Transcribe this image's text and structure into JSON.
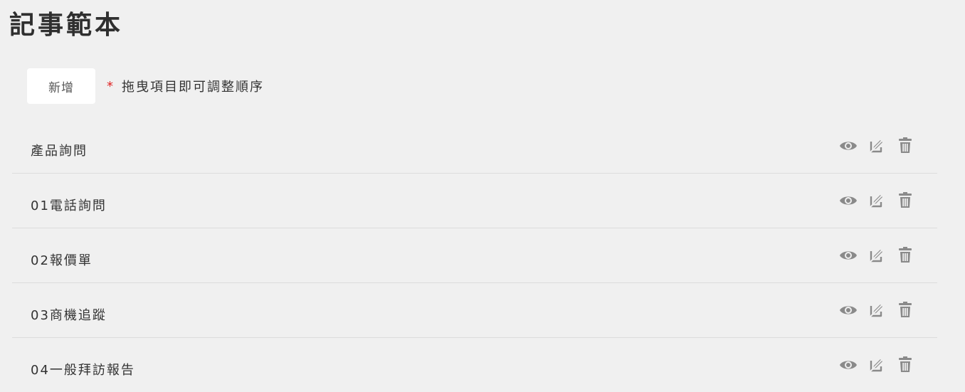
{
  "page": {
    "title": "記事範本"
  },
  "toolbar": {
    "add_label": "新增",
    "hint_asterisk": "*",
    "hint_text": "拖曳項目即可調整順序"
  },
  "colors": {
    "background": "#f0f0f0",
    "asterisk": "#e02424",
    "icon": "#8a8a8a",
    "divider": "#dcdcdc"
  },
  "templates": [
    {
      "label": "產品詢問",
      "icons": [
        "eye-icon",
        "edit-icon",
        "trash-icon"
      ]
    },
    {
      "label": "01電話詢問",
      "icons": [
        "eye-icon",
        "edit-icon",
        "trash-icon"
      ]
    },
    {
      "label": "02報價單",
      "icons": [
        "eye-icon",
        "edit-icon",
        "trash-icon"
      ]
    },
    {
      "label": "03商機追蹤",
      "icons": [
        "eye-icon",
        "edit-icon",
        "trash-icon"
      ]
    },
    {
      "label": "04一般拜訪報告",
      "icons": [
        "eye-icon",
        "edit-icon",
        "trash-icon"
      ]
    }
  ]
}
